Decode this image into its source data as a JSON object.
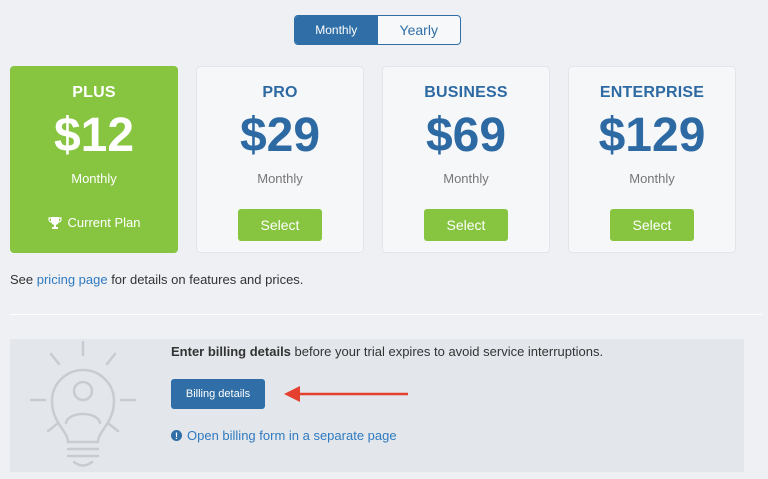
{
  "billing_toggle": {
    "monthly_label": "Monthly",
    "yearly_label": "Yearly"
  },
  "plans": [
    {
      "name": "PLUS",
      "price": "$12",
      "period": "Monthly",
      "status_label": "Current Plan"
    },
    {
      "name": "PRO",
      "price": "$29",
      "period": "Monthly",
      "button_label": "Select"
    },
    {
      "name": "BUSINESS",
      "price": "$69",
      "period": "Monthly",
      "button_label": "Select"
    },
    {
      "name": "ENTERPRISE",
      "price": "$129",
      "period": "Monthly",
      "button_label": "Select"
    }
  ],
  "pricing_note": {
    "prefix": "See ",
    "link": "pricing page",
    "suffix": " for details on features and prices."
  },
  "billing": {
    "message_bold": "Enter billing details",
    "message_rest": " before your trial expires to avoid service interruptions.",
    "button_label": "Billing details",
    "open_link": "Open billing form in a separate page"
  },
  "colors": {
    "accent_blue": "#2f6ea6",
    "accent_green": "#87c540",
    "arrow_red": "#e43f2f"
  },
  "icons": [
    "trophy-icon",
    "lightbulb-person-icon",
    "red-arrow-icon",
    "info-icon"
  ]
}
